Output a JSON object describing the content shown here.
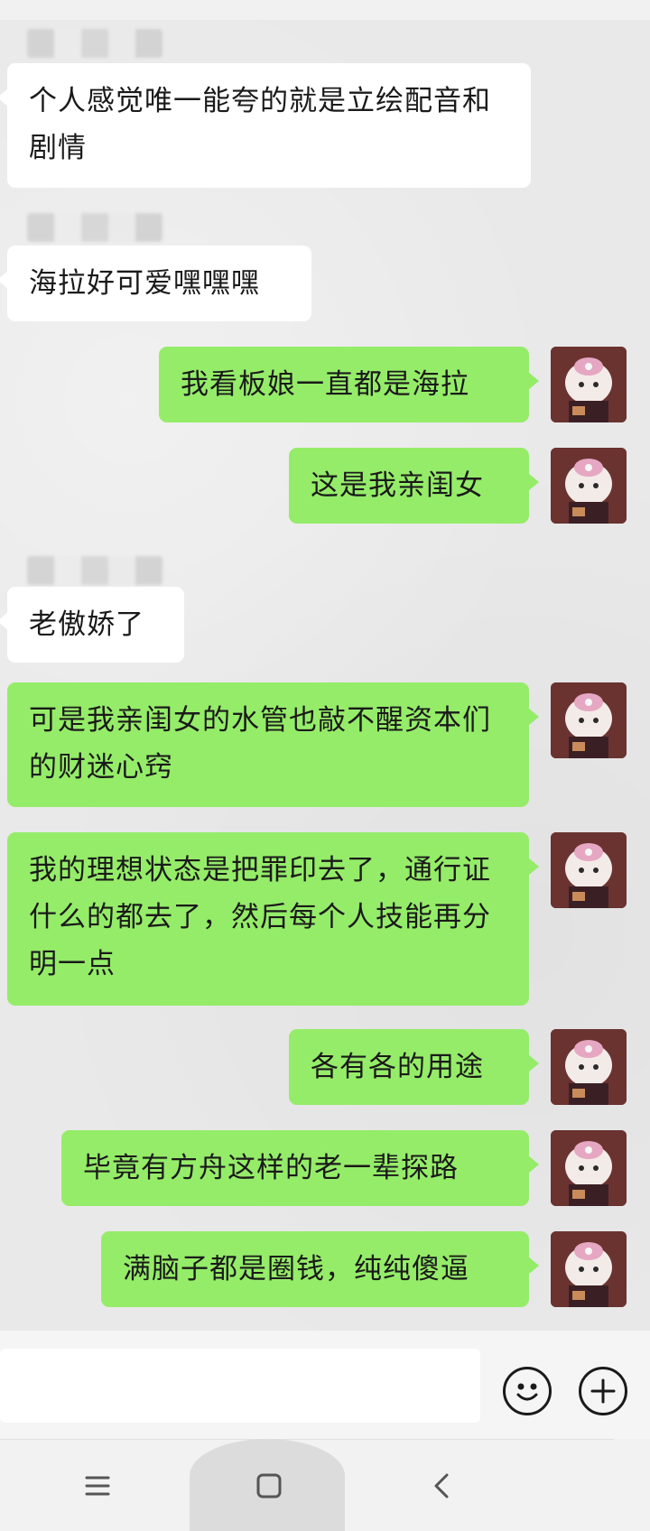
{
  "messages": [
    {
      "side": "in",
      "text": "个人感觉唯一能夸的就是立绘配音和剧情"
    },
    {
      "side": "in",
      "text": "海拉好可爱嘿嘿嘿"
    },
    {
      "side": "out",
      "text": "我看板娘一直都是海拉"
    },
    {
      "side": "out",
      "text": "这是我亲闺女"
    },
    {
      "side": "in",
      "text": "老傲娇了"
    },
    {
      "side": "out",
      "text": "可是我亲闺女的水管也敲不醒资本们的财迷心窍"
    },
    {
      "side": "out",
      "text": "我的理想状态是把罪印去了，通行证什么的都去了，然后每个人技能再分明一点"
    },
    {
      "side": "out",
      "text": "各有各的用途"
    },
    {
      "side": "out",
      "text": "毕竟有方舟这样的老一辈探路"
    },
    {
      "side": "out",
      "text": "满脑子都是圈钱，纯纯傻逼"
    }
  ],
  "input": {
    "placeholder": ""
  },
  "icons": {
    "emoji": "emoji-icon",
    "add": "add-icon",
    "menu": "menu-icon",
    "home": "home-icon",
    "back": "back-icon"
  },
  "colors": {
    "bubble_out": "#95ec69",
    "bubble_in": "#ffffff",
    "chat_bg": "#e9e9e9"
  }
}
